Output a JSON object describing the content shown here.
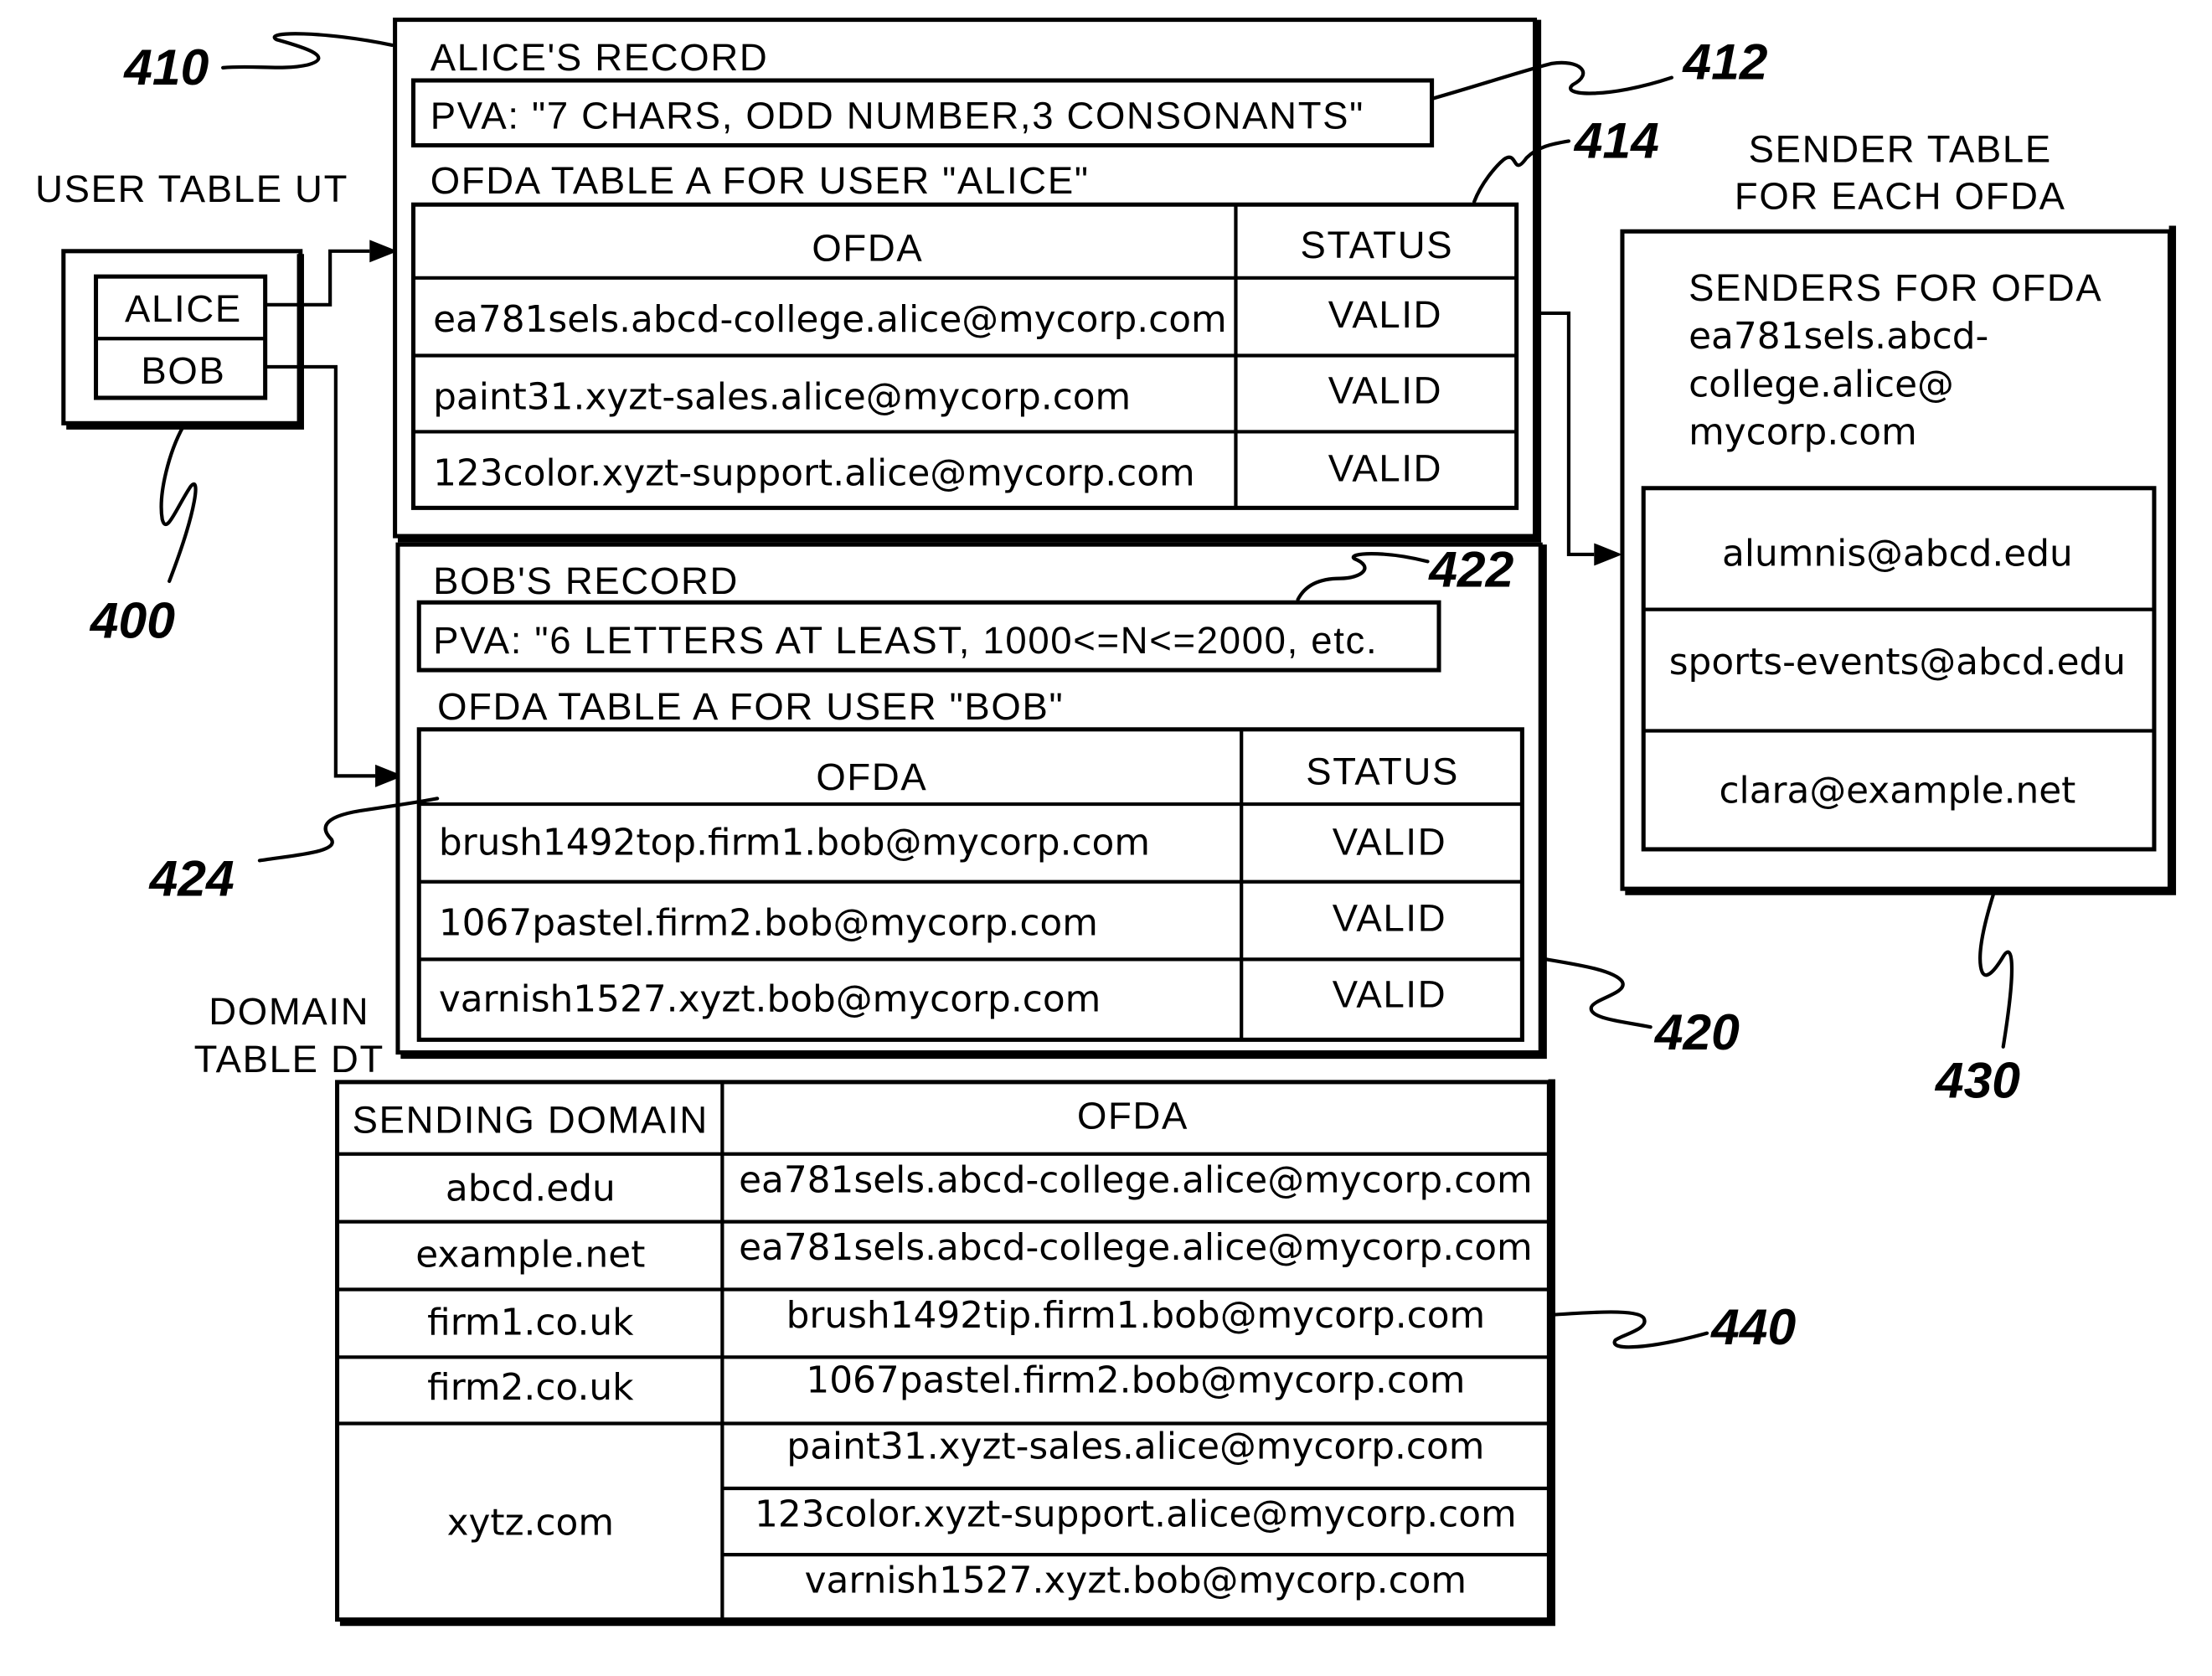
{
  "figure": {
    "references": {
      "user_table": "400",
      "alice_record": "410",
      "alice_pva": "412",
      "alice_ofda_table": "414",
      "bob_record": "420",
      "bob_pva": "422",
      "bob_ofda_table": "424",
      "sender_table": "430",
      "domain_table": "440"
    }
  },
  "user_table": {
    "title": "USER TABLE UT",
    "users": [
      "ALICE",
      "BOB"
    ]
  },
  "alice_record": {
    "title": "ALICE'S RECORD",
    "pva": "PVA: \"7 CHARS, ODD NUMBER,3 CONSONANTS\"",
    "table_title": "OFDA TABLE A FOR USER \"ALICE\"",
    "columns": [
      "OFDA",
      "STATUS"
    ],
    "rows": [
      {
        "ofda": "ea781sels.abcd-college.alice@mycorp.com",
        "status": "VALID"
      },
      {
        "ofda": "paint31.xyzt-sales.alice@mycorp.com",
        "status": "VALID"
      },
      {
        "ofda": "123color.xyzt-support.alice@mycorp.com",
        "status": "VALID"
      }
    ]
  },
  "bob_record": {
    "title": "BOB'S RECORD",
    "pva": "PVA: \"6 LETTERS AT LEAST, 1000<=N<=2000, etc.",
    "table_title": "OFDA TABLE A FOR USER \"BOB\"",
    "columns": [
      "OFDA",
      "STATUS"
    ],
    "rows": [
      {
        "ofda": "brush1492top.firm1.bob@mycorp.com",
        "status": "VALID"
      },
      {
        "ofda": "1067pastel.firm2.bob@mycorp.com",
        "status": "VALID"
      },
      {
        "ofda": "varnish1527.xyzt.bob@mycorp.com",
        "status": "VALID"
      }
    ]
  },
  "sender_table": {
    "title_line1": "SENDER TABLE",
    "title_line2": "FOR EACH OFDA",
    "heading_lines": [
      "SENDERS FOR OFDA",
      "ea781sels.abcd-",
      "college.alice@",
      "mycorp.com"
    ],
    "senders": [
      "alumnis@abcd.edu",
      "sports-events@abcd.edu",
      "clara@example.net"
    ]
  },
  "domain_table": {
    "title_line1": "DOMAIN",
    "title_line2": "TABLE DT",
    "columns": [
      "SENDING DOMAIN",
      "OFDA"
    ],
    "rows": [
      {
        "domain": "abcd.edu",
        "ofdas": [
          "ea781sels.abcd-college.alice@mycorp.com"
        ]
      },
      {
        "domain": "example.net",
        "ofdas": [
          "ea781sels.abcd-college.alice@mycorp.com"
        ]
      },
      {
        "domain": "firm1.co.uk",
        "ofdas": [
          "brush1492tip.firm1.bob@mycorp.com"
        ]
      },
      {
        "domain": "firm2.co.uk",
        "ofdas": [
          "1067pastel.firm2.bob@mycorp.com"
        ]
      },
      {
        "domain": "xytz.com",
        "ofdas": [
          "paint31.xyzt-sales.alice@mycorp.com",
          "123color.xyzt-support.alice@mycorp.com",
          "varnish1527.xyzt.bob@mycorp.com"
        ]
      }
    ]
  }
}
